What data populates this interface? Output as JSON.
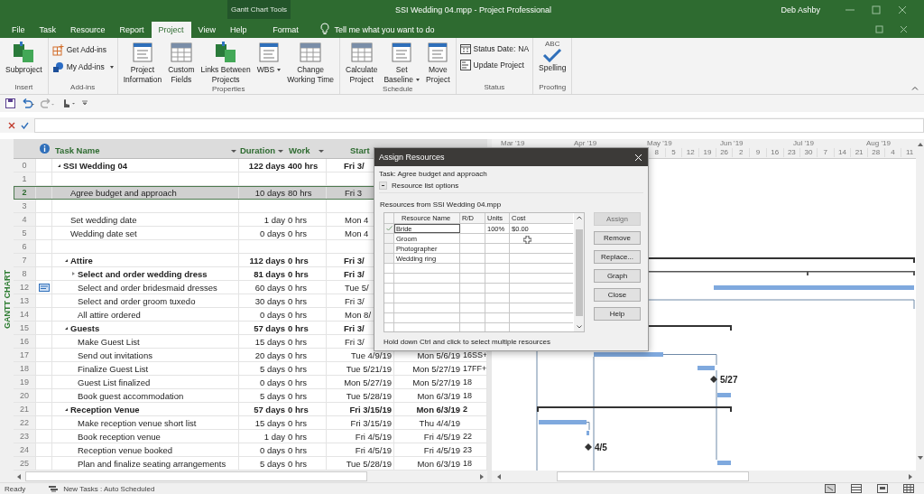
{
  "title_bar": {
    "context": "Gantt Chart Tools",
    "title": "SSI Wedding 04.mpp  -  Project Professional",
    "user": "Deb Ashby"
  },
  "tabs": [
    {
      "label": "File",
      "selected": false,
      "kind": "plain"
    },
    {
      "label": "Task",
      "selected": false,
      "kind": "plain"
    },
    {
      "label": "Resource",
      "selected": false,
      "kind": "plain"
    },
    {
      "label": "Report",
      "selected": false,
      "kind": "plain"
    },
    {
      "label": "Project",
      "selected": true,
      "kind": "plain"
    },
    {
      "label": "View",
      "selected": false,
      "kind": "plain"
    },
    {
      "label": "Help",
      "selected": false,
      "kind": "plain"
    },
    {
      "label": "Format",
      "selected": false,
      "kind": "contextual"
    }
  ],
  "tell_me": "Tell me what you want to do",
  "ribbon": [
    {
      "label": "Insert",
      "buttons": [
        {
          "label": "Subproject",
          "kind": "large"
        }
      ]
    },
    {
      "label": "Add-ins",
      "buttons": [
        {
          "label": "Get Add-ins",
          "kind": "small"
        },
        {
          "label": "My Add-ins",
          "kind": "small",
          "dropdown": true
        }
      ]
    },
    {
      "label": "Properties",
      "buttons": [
        {
          "label": "Project\nInformation",
          "kind": "large"
        },
        {
          "label": "Custom\nFields",
          "kind": "large"
        },
        {
          "label": "Links Between\nProjects",
          "kind": "large"
        },
        {
          "label": "WBS",
          "kind": "large",
          "dropdown": true
        },
        {
          "label": "Change\nWorking Time",
          "kind": "large"
        }
      ]
    },
    {
      "label": "Schedule",
      "buttons": [
        {
          "label": "Calculate\nProject",
          "kind": "large"
        },
        {
          "label": "Set\nBaseline",
          "kind": "large",
          "dropdown": true
        },
        {
          "label": "Move\nProject",
          "kind": "large"
        }
      ]
    },
    {
      "label": "Status",
      "buttons": [
        {
          "label": "Status Date:",
          "kind": "small",
          "value": "NA"
        },
        {
          "label": "Update Project",
          "kind": "small"
        }
      ]
    },
    {
      "label": "Proofing",
      "buttons": [
        {
          "label": "Spelling",
          "kind": "large",
          "icon_text": "ABC"
        }
      ]
    }
  ],
  "table": {
    "columns": [
      {
        "label": "Task Name",
        "dropdown": true
      },
      {
        "label": "Duration",
        "dropdown": true
      },
      {
        "label": "Work",
        "dropdown": true
      },
      {
        "label": "Start"
      }
    ],
    "rows": [
      {
        "row_number": "0",
        "name": "SSI Wedding 04",
        "kind": "summary",
        "expanded": true,
        "selected": false,
        "duration": "122 days",
        "work": "400 hrs",
        "start": "Fri 3/",
        "children": [
          {
            "row_number": "1",
            "kind": "blank",
            "selected": false
          },
          {
            "row_number": "2",
            "name": "Agree budget and approach",
            "kind": "task",
            "selected": true,
            "duration": "10 days",
            "work": "80 hrs",
            "start": "Fri 3"
          },
          {
            "row_number": "3",
            "kind": "blank",
            "selected": false
          },
          {
            "row_number": "4",
            "name": "Set wedding date",
            "kind": "task",
            "selected": false,
            "duration": "1 day",
            "work": "0 hrs",
            "start": "Mon 4"
          },
          {
            "row_number": "5",
            "name": "Wedding date set",
            "kind": "task",
            "selected": false,
            "duration": "0 days",
            "work": "0 hrs",
            "start": "Mon 4"
          },
          {
            "row_number": "6",
            "kind": "blank",
            "selected": false
          },
          {
            "row_number": "7",
            "name": "Attire",
            "kind": "summary",
            "expanded": true,
            "selected": false,
            "duration": "112 days",
            "work": "0 hrs",
            "start": "Fri 3/",
            "children": [
              {
                "row_number": "8",
                "name": "Select and order wedding dress",
                "kind": "summary",
                "expanded": false,
                "selected": false,
                "duration": "81 days",
                "work": "0 hrs",
                "start": "Fri 3/"
              },
              {
                "row_number": "12",
                "name": "Select and order bridesmaid dresses",
                "kind": "task",
                "note": true,
                "selected": false,
                "duration": "60 days",
                "work": "0 hrs",
                "start": "Tue 5/"
              },
              {
                "row_number": "13",
                "name": "Select and order groom tuxedo",
                "kind": "task",
                "selected": false,
                "duration": "30 days",
                "work": "0 hrs",
                "start": "Fri 3/"
              },
              {
                "row_number": "14",
                "name": "All attire ordered",
                "kind": "task",
                "selected": false,
                "duration": "0 days",
                "work": "0 hrs",
                "start": "Mon 8/"
              }
            ]
          },
          {
            "row_number": "15",
            "name": "Guests",
            "kind": "summary",
            "expanded": true,
            "selected": false,
            "duration": "57 days",
            "work": "0 hrs",
            "start": "Fri 3/",
            "children": [
              {
                "row_number": "16",
                "name": "Make Guest List",
                "kind": "task",
                "selected": false,
                "duration": "15 days",
                "work": "0 hrs",
                "start": "Fri 3/"
              },
              {
                "row_number": "17",
                "name": "Send out invitations",
                "kind": "task",
                "selected": false,
                "duration": "20 days",
                "work": "0 hrs",
                "start": "Tue 4/9/19",
                "finish": "Mon 5/6/19",
                "predecessors": "16SS+"
              },
              {
                "row_number": "18",
                "name": "Finalize Guest List",
                "kind": "task",
                "selected": false,
                "duration": "5 days",
                "work": "0 hrs",
                "start": "Tue 5/21/19",
                "finish": "Mon 5/27/19",
                "predecessors": "17FF+"
              },
              {
                "row_number": "19",
                "name": "Guest List finalized",
                "kind": "task",
                "selected": false,
                "duration": "0 days",
                "work": "0 hrs",
                "start": "Mon 5/27/19",
                "finish": "Mon 5/27/19",
                "predecessors": "18"
              },
              {
                "row_number": "20",
                "name": "Book guest accommodation",
                "kind": "task",
                "selected": false,
                "duration": "5 days",
                "work": "0 hrs",
                "start": "Tue 5/28/19",
                "finish": "Mon 6/3/19",
                "predecessors": "18"
              }
            ]
          },
          {
            "row_number": "21",
            "name": "Reception Venue",
            "kind": "summary",
            "expanded": true,
            "selected": false,
            "duration": "57 days",
            "work": "0 hrs",
            "start": "Fri 3/15/19",
            "finish": "Mon 6/3/19",
            "predecessors": "2",
            "children": [
              {
                "row_number": "22",
                "name": "Make reception venue short list",
                "kind": "task",
                "selected": false,
                "duration": "15 days",
                "work": "0 hrs",
                "start": "Fri 3/15/19",
                "finish": "Thu 4/4/19"
              },
              {
                "row_number": "23",
                "name": "Book reception venue",
                "kind": "task",
                "selected": false,
                "duration": "1 day",
                "work": "0 hrs",
                "start": "Fri 4/5/19",
                "finish": "Fri 4/5/19",
                "predecessors": "22"
              },
              {
                "row_number": "24",
                "name": "Reception venue booked",
                "kind": "task",
                "selected": false,
                "duration": "0 days",
                "work": "0 hrs",
                "start": "Fri 4/5/19",
                "finish": "Fri 4/5/19",
                "predecessors": "23"
              },
              {
                "row_number": "25",
                "name": "Plan and finalize seating arrangements",
                "kind": "task",
                "selected": false,
                "duration": "5 days",
                "work": "0 hrs",
                "start": "Tue 5/28/19",
                "finish": "Mon 6/3/19",
                "predecessors": "18"
              }
            ]
          }
        ]
      }
    ]
  },
  "view_label": "GANTT CHART",
  "timescale": {
    "months": [
      "Mar '19",
      "Apr '19",
      "May '19",
      "Jun '19",
      "Jul '19",
      "Aug '19"
    ],
    "days": [
      "8",
      "5",
      "12",
      "19",
      "26",
      "2",
      "9",
      "16",
      "23",
      "30",
      "7",
      "14",
      "21",
      "28",
      "4",
      "11"
    ]
  },
  "gantt": {
    "milestone_labels": [
      "5/27",
      "4/5"
    ]
  },
  "dialog": {
    "title": "Assign Resources",
    "task": "Task: Agree budget and approach",
    "options": "Resource list options",
    "source": "Resources from SSI Wedding 04.mpp",
    "columns": [
      "Resource Name",
      "R/D",
      "Units",
      "Cost"
    ],
    "resources": [
      {
        "name": "Bride",
        "assigned": true,
        "selected": true,
        "units": "100%",
        "cost": "$0.00"
      },
      {
        "name": "Groom",
        "assigned": false,
        "selected": false
      },
      {
        "name": "Photographer",
        "assigned": false,
        "selected": false
      },
      {
        "name": "Wedding ring",
        "assigned": false,
        "selected": false
      }
    ],
    "buttons": [
      {
        "label": "Assign",
        "disabled": true
      },
      {
        "label": "Remove",
        "disabled": false
      },
      {
        "label": "Replace...",
        "disabled": false
      },
      {
        "label": "Graph",
        "disabled": false
      },
      {
        "label": "Close",
        "disabled": false
      },
      {
        "label": "Help",
        "disabled": false
      }
    ],
    "hint": "Hold down Ctrl and click to select multiple resources"
  },
  "status_bar": {
    "state": "Ready",
    "mode": "New Tasks : Auto Scheduled"
  }
}
